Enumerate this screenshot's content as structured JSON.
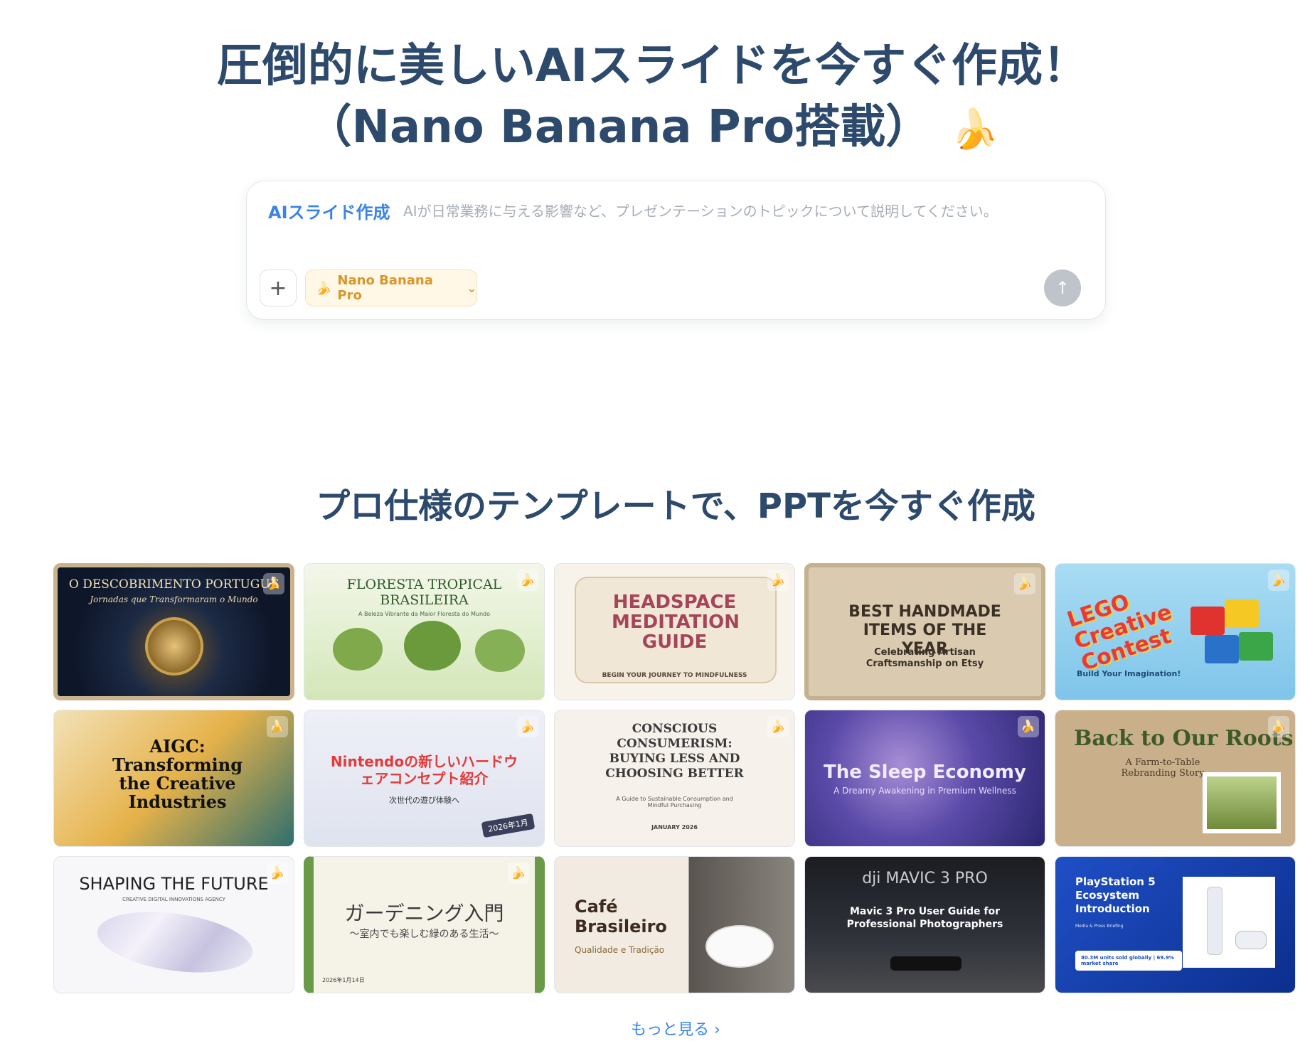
{
  "hero": {
    "title_line1": "圧倒的に美しいAIスライドを今すぐ作成！",
    "title_line2": "（Nano Banana Pro搭載）",
    "emoji": "🍌"
  },
  "prompt": {
    "label": "AIスライド作成",
    "placeholder": "AIが日常業務に与える影響など、プレゼンテーションのトピックについて説明してください。",
    "add_icon": "+",
    "model": "Nano Banana Pro",
    "model_icon": "🍌",
    "send_icon": "↑"
  },
  "templates": {
    "title": "プロ仕様のテンプレートで、PPTを今すぐ作成",
    "badge_icon": "🍌",
    "cards": [
      {
        "title": "O DESCOBRIMENTO PORTUGUÊ",
        "subtitle": "Jornadas que Transformaram o Mundo"
      },
      {
        "title": "FLORESTA TROPICAL BRASILEIRA",
        "subtitle": "A Beleza Vibrante da Maior Floresta do Mundo"
      },
      {
        "title": "HEADSPACE MEDITATION GUIDE",
        "subtitle": "BEGIN YOUR JOURNEY TO MINDFULNESS"
      },
      {
        "title": "BEST HANDMADE ITEMS OF THE YEAR",
        "subtitle": "Celebrating Artisan Craftsmanship on Etsy"
      },
      {
        "title": "LEGO Creative Contest",
        "subtitle": "Build Your Imagination!"
      },
      {
        "title": "AIGC: Transforming the Creative Industries",
        "subtitle": ""
      },
      {
        "title": "Nintendoの新しいハードウェアコンセプト紹介",
        "subtitle": "次世代の遊び体験へ",
        "tag": "2026年1月"
      },
      {
        "title": "CONSCIOUS CONSUMERISM: BUYING LESS AND CHOOSING BETTER",
        "subtitle": "A Guide to Sustainable Consumption and Mindful Purchasing",
        "date": "JANUARY 2026"
      },
      {
        "title": "The Sleep Economy",
        "subtitle": "A Dreamy Awakening in Premium Wellness"
      },
      {
        "title": "Back to Our Roots",
        "subtitle": "A Farm-to-Table Rebranding Story"
      },
      {
        "title": "SHAPING THE FUTURE",
        "subtitle": "CREATIVE DIGITAL INNOVATIONS AGENCY"
      },
      {
        "title": "ガーデニング入門",
        "subtitle": "～室内でも楽しむ緑のある生活～",
        "date": "2026年1月14日"
      },
      {
        "title": "Café Brasileiro",
        "subtitle": "Qualidade e Tradição"
      },
      {
        "title": "Mavic 3 Pro User Guide for Professional Photographers",
        "brand": "dji MAVIC 3 PRO"
      },
      {
        "title": "PlayStation 5 Ecosystem Introduction",
        "subtitle": "Media & Press Briefing",
        "stat": "80.3M units sold globally | 69.9% market share"
      }
    ]
  },
  "more_link": "もっと見る ›"
}
